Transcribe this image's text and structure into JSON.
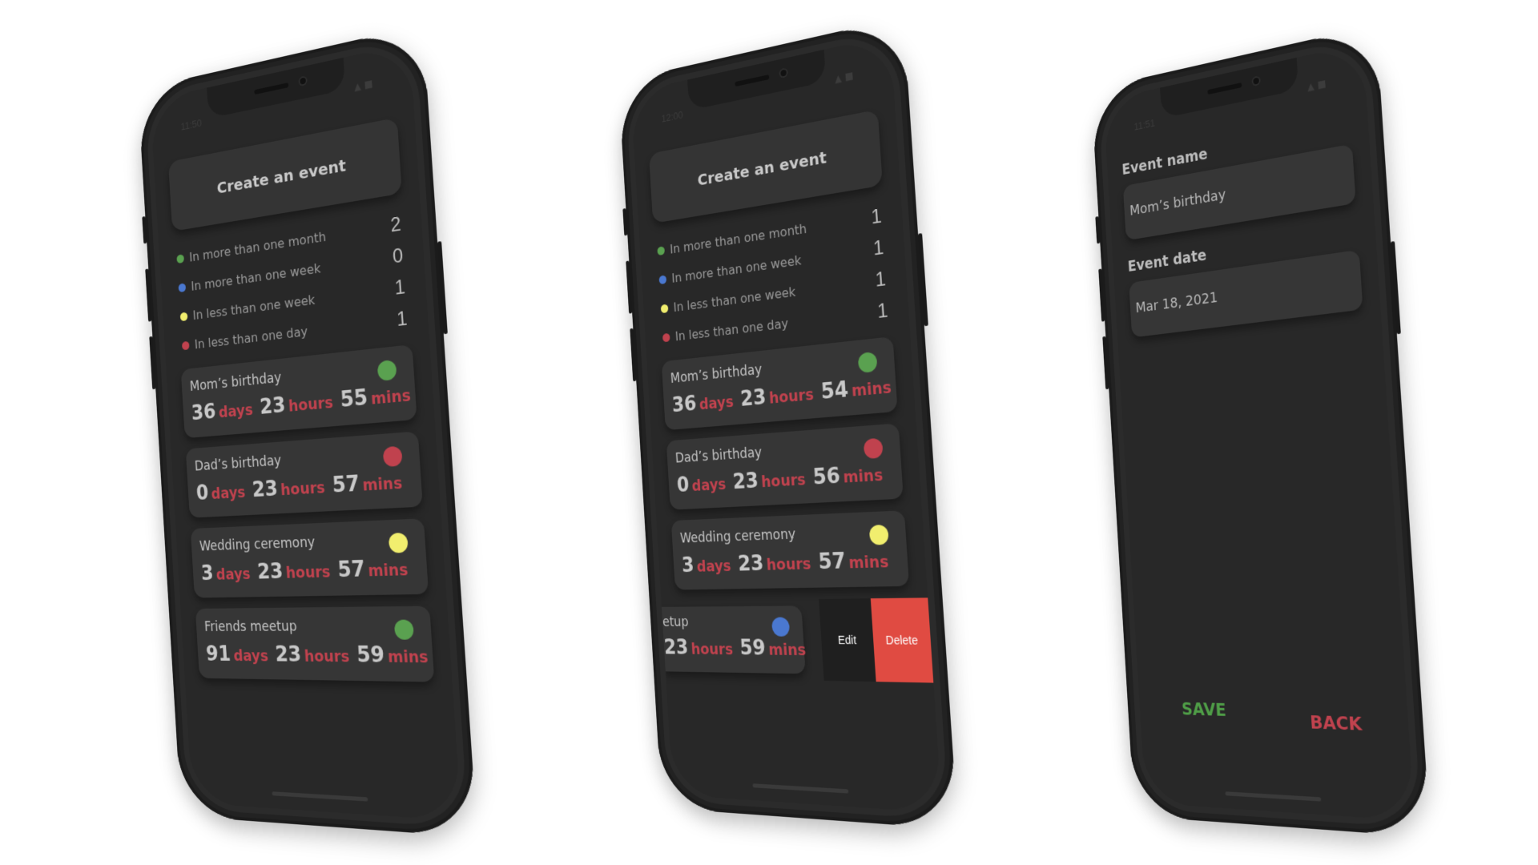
{
  "colors": {
    "green": "#5aa150",
    "blue": "#4a78d0",
    "yellow": "#f1ee6e",
    "red": "#c0424e",
    "delete": "#e04b42"
  },
  "phones": [
    {
      "status_time": "11:50",
      "create_label": "Create an event",
      "legend": [
        {
          "label": "In more than one month",
          "count": "2",
          "color": "green"
        },
        {
          "label": "In more than one week",
          "count": "0",
          "color": "blue"
        },
        {
          "label": "In less than one week",
          "count": "1",
          "color": "yellow"
        },
        {
          "label": "In less than one day",
          "count": "1",
          "color": "red"
        }
      ],
      "events": [
        {
          "name": "Mom’s birthday",
          "days": "36",
          "hours": "23",
          "mins": "55",
          "color": "green"
        },
        {
          "name": "Dad’s birthday",
          "days": "0",
          "hours": "23",
          "mins": "57",
          "color": "red"
        },
        {
          "name": "Wedding ceremony",
          "days": "3",
          "hours": "23",
          "mins": "57",
          "color": "yellow"
        },
        {
          "name": "Friends meetup",
          "days": "91",
          "hours": "23",
          "mins": "59",
          "color": "green"
        }
      ]
    },
    {
      "status_time": "12:00",
      "create_label": "Create an event",
      "legend": [
        {
          "label": "In more than one month",
          "count": "1",
          "color": "green"
        },
        {
          "label": "In more than one week",
          "count": "1",
          "color": "blue"
        },
        {
          "label": "In less than one week",
          "count": "1",
          "color": "yellow"
        },
        {
          "label": "In less than one day",
          "count": "1",
          "color": "red"
        }
      ],
      "events": [
        {
          "name": "Mom’s birthday",
          "days": "36",
          "hours": "23",
          "mins": "54",
          "color": "green"
        },
        {
          "name": "Dad’s birthday",
          "days": "0",
          "hours": "23",
          "mins": "56",
          "color": "red"
        },
        {
          "name": "Wedding ceremony",
          "days": "3",
          "hours": "23",
          "mins": "57",
          "color": "yellow"
        }
      ],
      "swiped_event": {
        "name": "etup",
        "hours": "23",
        "mins": "59",
        "color": "blue"
      },
      "edit_label": "Edit",
      "delete_label": "Delete"
    },
    {
      "status_time": "11:51",
      "event_name_label": "Event name",
      "event_name_value": "Mom’s birthday",
      "event_date_label": "Event date",
      "event_date_value": "Mar 18, 2021",
      "save_label": "SAVE",
      "back_label": "BACK"
    }
  ],
  "units": {
    "days": "days",
    "hours": "hours",
    "mins": "mins"
  },
  "icons": {
    "status": "signal-wifi-battery-icons"
  }
}
